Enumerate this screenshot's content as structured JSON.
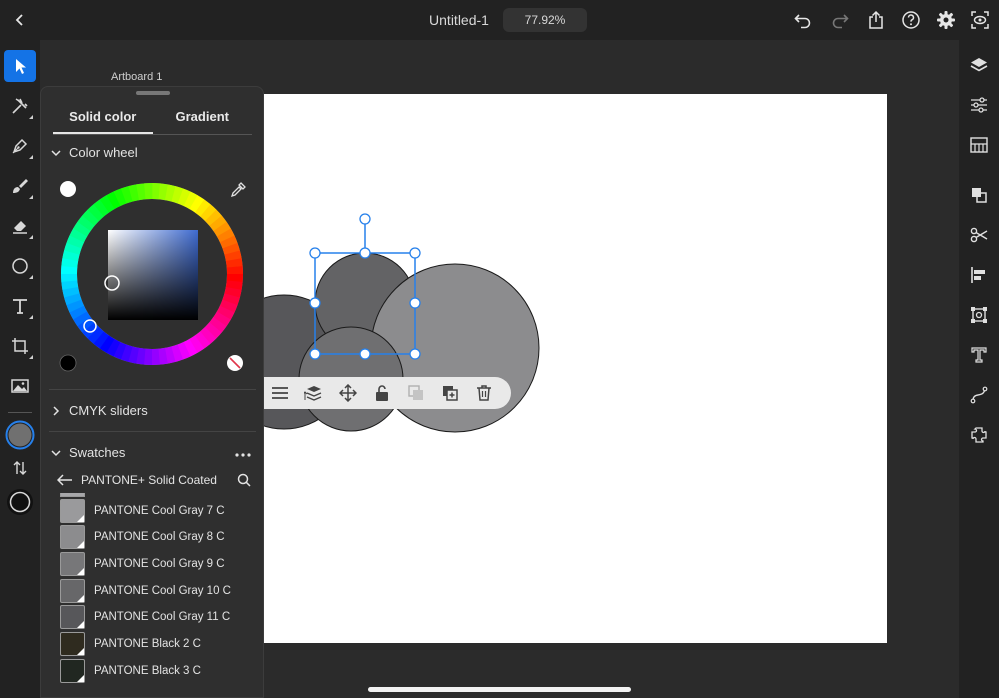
{
  "topbar": {
    "title": "Untitled-1",
    "zoom": "77.92%"
  },
  "icons": {
    "back": "chevron-left-icon",
    "undo": "undo-icon",
    "redo": "redo-icon",
    "share": "share-icon",
    "help": "help-icon",
    "settings": "gear-icon",
    "preview": "preview-icon"
  },
  "canvas": {
    "artboard_label": "Artboard 1"
  },
  "color_panel": {
    "tabs": [
      "Solid color",
      "Gradient"
    ],
    "active_tab": "Solid color",
    "color_wheel_label": "Color wheel",
    "cmyk_label": "CMYK sliders",
    "swatches_label": "Swatches",
    "library_name": "PANTONE+ Solid Coated",
    "selected_color": "#707070",
    "swatches": [
      {
        "name": "PANTONE Cool Gray 7 C",
        "color": "#9a9a9c"
      },
      {
        "name": "PANTONE Cool Gray 8 C",
        "color": "#8c8c8e"
      },
      {
        "name": "PANTONE Cool Gray 9 C",
        "color": "#777779"
      },
      {
        "name": "PANTONE Cool Gray 10 C",
        "color": "#676769"
      },
      {
        "name": "PANTONE Cool Gray 11 C",
        "color": "#57575a"
      },
      {
        "name": "PANTONE Black 2 C",
        "color": "#2f2b1f"
      },
      {
        "name": "PANTONE Black 3 C",
        "color": "#212721"
      }
    ]
  },
  "colors": {
    "accent": "#1473e6",
    "selection": "#2680eb"
  }
}
